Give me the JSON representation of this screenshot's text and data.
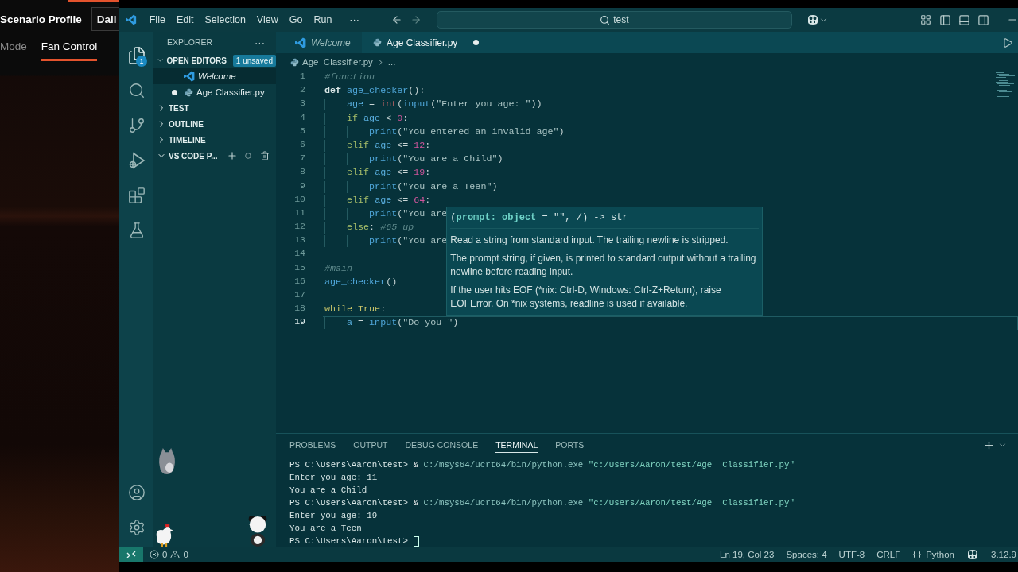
{
  "side_app": {
    "title": "Scenario Profile",
    "profile_button": "Dail",
    "tabs": [
      {
        "label": "Mode",
        "selected": false
      },
      {
        "label": "Fan Control",
        "selected": true
      }
    ]
  },
  "window": {
    "menu": [
      "File",
      "Edit",
      "Selection",
      "View",
      "Go",
      "Run"
    ],
    "more": "···",
    "command_center": "test"
  },
  "activity_bar": {
    "explorer_badge": "1"
  },
  "sidebar": {
    "title": "EXPLORER",
    "more": "···",
    "sections": [
      {
        "label": "OPEN EDITORS",
        "expanded": true,
        "badge": "1 unsaved",
        "items": [
          {
            "label": "Welcome",
            "kind": "welcome",
            "preview": true,
            "dirty": false,
            "selected": true
          },
          {
            "label": "Age  Classifier.py",
            "kind": "python",
            "preview": false,
            "dirty": true,
            "selected": false
          }
        ]
      },
      {
        "label": "TEST",
        "expanded": false
      },
      {
        "label": "OUTLINE",
        "expanded": false
      },
      {
        "label": "TIMELINE",
        "expanded": false
      },
      {
        "label": "VS CODE P...",
        "expanded": true,
        "actions": true
      }
    ]
  },
  "tabs": [
    {
      "label": "Welcome",
      "kind": "welcome",
      "preview": true,
      "dirty": false,
      "selected": false
    },
    {
      "label": "Age Classifier.py",
      "kind": "python",
      "preview": false,
      "dirty": true,
      "selected": true
    }
  ],
  "breadcrumb": {
    "file": "Age  Classifier.py",
    "more": "..."
  },
  "editor": {
    "lines": [
      {
        "number": "1",
        "current": false,
        "tokens": [
          {
            "kind": "comment",
            "text": "#function"
          }
        ]
      },
      {
        "number": "2",
        "current": false,
        "tokens": [
          {
            "kind": "keyword",
            "text": "def "
          },
          {
            "kind": "function",
            "text": "age_checker"
          },
          {
            "kind": "punct",
            "text": "():"
          }
        ]
      },
      {
        "number": "3",
        "current": false,
        "tokens": [
          {
            "kind": "variable",
            "text": "    age"
          },
          {
            "kind": "punct",
            "text": " = "
          },
          {
            "kind": "builtin",
            "text": "int"
          },
          {
            "kind": "punct",
            "text": "("
          },
          {
            "kind": "function",
            "text": "input"
          },
          {
            "kind": "punct",
            "text": "("
          },
          {
            "kind": "string",
            "text": "\"Enter you age: \""
          },
          {
            "kind": "punct",
            "text": "))"
          }
        ]
      },
      {
        "number": "4",
        "current": false,
        "tokens": [
          {
            "kind": "control",
            "text": "    if "
          },
          {
            "kind": "variable",
            "text": "age"
          },
          {
            "kind": "punct",
            "text": " < "
          },
          {
            "kind": "number",
            "text": "0"
          },
          {
            "kind": "punct",
            "text": ":"
          }
        ]
      },
      {
        "number": "5",
        "current": false,
        "tokens": [
          {
            "kind": "function",
            "text": "        print"
          },
          {
            "kind": "punct",
            "text": "("
          },
          {
            "kind": "string",
            "text": "\"You entered an invalid age\""
          },
          {
            "kind": "punct",
            "text": ")"
          }
        ]
      },
      {
        "number": "6",
        "current": false,
        "tokens": [
          {
            "kind": "control",
            "text": "    elif "
          },
          {
            "kind": "variable",
            "text": "age"
          },
          {
            "kind": "punct",
            "text": " <= "
          },
          {
            "kind": "number",
            "text": "12"
          },
          {
            "kind": "punct",
            "text": ":"
          }
        ]
      },
      {
        "number": "7",
        "current": false,
        "tokens": [
          {
            "kind": "function",
            "text": "        print"
          },
          {
            "kind": "punct",
            "text": "("
          },
          {
            "kind": "string",
            "text": "\"You are a Child\""
          },
          {
            "kind": "punct",
            "text": ")"
          }
        ]
      },
      {
        "number": "8",
        "current": false,
        "tokens": [
          {
            "kind": "control",
            "text": "    elif "
          },
          {
            "kind": "variable",
            "text": "age"
          },
          {
            "kind": "punct",
            "text": " <= "
          },
          {
            "kind": "number",
            "text": "19"
          },
          {
            "kind": "punct",
            "text": ":"
          }
        ]
      },
      {
        "number": "9",
        "current": false,
        "tokens": [
          {
            "kind": "function",
            "text": "        print"
          },
          {
            "kind": "punct",
            "text": "("
          },
          {
            "kind": "string",
            "text": "\"You are a Teen\""
          },
          {
            "kind": "punct",
            "text": ")"
          }
        ]
      },
      {
        "number": "10",
        "current": false,
        "tokens": [
          {
            "kind": "control",
            "text": "    elif "
          },
          {
            "kind": "variable",
            "text": "age"
          },
          {
            "kind": "punct",
            "text": " <= "
          },
          {
            "kind": "number",
            "text": "64"
          },
          {
            "kind": "punct",
            "text": ":"
          }
        ]
      },
      {
        "number": "11",
        "current": false,
        "tokens": [
          {
            "kind": "function",
            "text": "        print"
          },
          {
            "kind": "punct",
            "text": "("
          },
          {
            "kind": "string",
            "text": "\"You are"
          }
        ]
      },
      {
        "number": "12",
        "current": false,
        "tokens": [
          {
            "kind": "control",
            "text": "    else"
          },
          {
            "kind": "punct",
            "text": ": "
          },
          {
            "kind": "comment",
            "text": "#65 up"
          }
        ]
      },
      {
        "number": "13",
        "current": false,
        "tokens": [
          {
            "kind": "function",
            "text": "        print"
          },
          {
            "kind": "punct",
            "text": "("
          },
          {
            "kind": "string",
            "text": "\"You are"
          }
        ]
      },
      {
        "number": "14",
        "current": false
      },
      {
        "number": "15",
        "current": false,
        "tokens": [
          {
            "kind": "comment",
            "text": "#main"
          }
        ]
      },
      {
        "number": "16",
        "current": false,
        "tokens": [
          {
            "kind": "function",
            "text": "age_checker"
          },
          {
            "kind": "punct",
            "text": "()"
          }
        ]
      },
      {
        "number": "17",
        "current": false
      },
      {
        "number": "18",
        "current": false,
        "tokens": [
          {
            "kind": "keyword2",
            "text": "while True"
          },
          {
            "kind": "punct",
            "text": ":"
          }
        ]
      },
      {
        "number": "19",
        "current": true,
        "tokens": [
          {
            "kind": "variable",
            "text": "    a"
          },
          {
            "kind": "punct",
            "text": " = "
          },
          {
            "kind": "function",
            "text": "input"
          },
          {
            "kind": "punct",
            "text": "("
          },
          {
            "kind": "string",
            "text": "\"Do you \""
          },
          {
            "kind": "punct",
            "text": ")"
          }
        ]
      }
    ],
    "hover": {
      "signature": "(**prompt: object** = \"\", /) -> str",
      "paragraphs": [
        "Read a string from standard input. The trailing newline is stripped.",
        "The prompt string, if given, is printed to standard output without a trailing newline before reading input.",
        "If the user hits EOF (*nix: Ctrl-D, Windows: Ctrl-Z+Return), raise EOFError. On *nix systems, readline is used if available."
      ]
    }
  },
  "panel": {
    "tabs": [
      {
        "label": "PROBLEMS",
        "selected": false
      },
      {
        "label": "OUTPUT",
        "selected": false
      },
      {
        "label": "DEBUG CONSOLE",
        "selected": false
      },
      {
        "label": "TERMINAL",
        "selected": true
      },
      {
        "label": "PORTS",
        "selected": false
      }
    ],
    "terminal": [
      {
        "cursor": false,
        "tokens": [
          {
            "kind": "prompt",
            "text": "PS C:\\Users\\Aaron\\test> "
          },
          {
            "kind": "op",
            "text": "& "
          },
          {
            "kind": "path",
            "text": "C:/msys64/ucrt64/bin/python.exe "
          },
          {
            "kind": "string",
            "text": "\"c:/Users/Aaron/test/Age  Classifier.py\""
          }
        ]
      },
      {
        "cursor": false,
        "tokens": [
          {
            "kind": "out",
            "text": "Enter you age: 11"
          }
        ]
      },
      {
        "cursor": false,
        "tokens": [
          {
            "kind": "out",
            "text": "You are a Child"
          }
        ]
      },
      {
        "cursor": false,
        "tokens": [
          {
            "kind": "prompt",
            "text": "PS C:\\Users\\Aaron\\test> "
          },
          {
            "kind": "op",
            "text": "& "
          },
          {
            "kind": "path",
            "text": "C:/msys64/ucrt64/bin/python.exe "
          },
          {
            "kind": "string",
            "text": "\"c:/Users/Aaron/test/Age  Classifier.py\""
          }
        ]
      },
      {
        "cursor": false,
        "tokens": [
          {
            "kind": "out",
            "text": "Enter you age: 19"
          }
        ]
      },
      {
        "cursor": false,
        "tokens": [
          {
            "kind": "out",
            "text": "You are a Teen"
          }
        ]
      },
      {
        "cursor": true,
        "tokens": [
          {
            "kind": "prompt",
            "text": "PS C:\\Users\\Aaron\\test> "
          }
        ]
      }
    ]
  },
  "pets": [
    {
      "kind": "cat"
    },
    {
      "kind": "chicken"
    },
    {
      "kind": "panda"
    }
  ],
  "status_bar": {
    "errors": "0",
    "warnings": "0",
    "items": [
      "Ln 19, Col 23",
      "Spaces: 4",
      "UTF-8",
      "CRLF"
    ],
    "language": "Python",
    "version": "3.12.9"
  }
}
